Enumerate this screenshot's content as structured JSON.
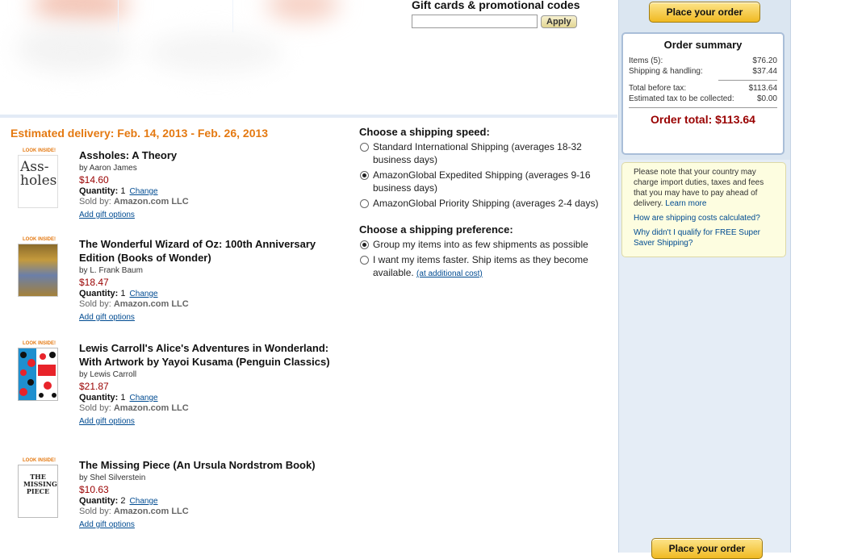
{
  "gift_cards": {
    "title": "Gift cards & promotional codes",
    "input_value": "",
    "apply_label": "Apply"
  },
  "delivery": {
    "estimate": "Estimated delivery: Feb. 14, 2013 - Feb. 26, 2013"
  },
  "items": [
    {
      "title": "Assholes: A Theory",
      "author": "by Aaron James",
      "price": "$14.60",
      "quantity_label": "Quantity:",
      "quantity": "1",
      "change_label": "Change",
      "sold_by_label": "Sold by:",
      "seller": "Amazon.com LLC",
      "gift_options_label": "Add gift options",
      "look_inside": "LOOK INSIDE!",
      "cover_text": "Ass-holes"
    },
    {
      "title": "The Wonderful Wizard of Oz: 100th Anniversary Edition (Books of Wonder)",
      "author": "by L. Frank Baum",
      "price": "$18.47",
      "quantity_label": "Quantity:",
      "quantity": "1",
      "change_label": "Change",
      "sold_by_label": "Sold by:",
      "seller": "Amazon.com LLC",
      "gift_options_label": "Add gift options",
      "look_inside": "LOOK INSIDE!",
      "cover_text": ""
    },
    {
      "title": "Lewis Carroll's Alice's Adventures in Wonderland: With Artwork by Yayoi Kusama (Penguin Classics)",
      "author": "by Lewis Carroll",
      "price": "$21.87",
      "quantity_label": "Quantity:",
      "quantity": "1",
      "change_label": "Change",
      "sold_by_label": "Sold by:",
      "seller": "Amazon.com LLC",
      "gift_options_label": "Add gift options",
      "look_inside": "LOOK INSIDE!",
      "cover_text": ""
    },
    {
      "title": "The Missing Piece (An Ursula Nordstrom Book)",
      "author": "by Shel Silverstein",
      "price": "$10.63",
      "quantity_label": "Quantity:",
      "quantity": "2",
      "change_label": "Change",
      "sold_by_label": "Sold by:",
      "seller": "Amazon.com LLC",
      "gift_options_label": "Add gift options",
      "look_inside": "LOOK INSIDE!",
      "cover_text": "THE MISSING PIECE"
    }
  ],
  "shipping_speed": {
    "title": "Choose a shipping speed:",
    "options": [
      {
        "label": "Standard International Shipping (averages 18-32 business days)",
        "selected": false
      },
      {
        "label": "AmazonGlobal Expedited Shipping (averages 9-16 business days)",
        "selected": true
      },
      {
        "label": "AmazonGlobal Priority Shipping (averages 2-4 days)",
        "selected": false
      }
    ]
  },
  "shipping_preference": {
    "title": "Choose a shipping preference:",
    "options": [
      {
        "label": "Group my items into as few shipments as possible",
        "selected": true
      },
      {
        "label": "I want my items faster. Ship items as they become available.",
        "selected": false,
        "link": "(at additional cost)"
      }
    ]
  },
  "sidebar": {
    "place_order_label": "Place your order",
    "summary": {
      "title": "Order summary",
      "items_label": "Items (5):",
      "items_value": "$76.20",
      "shipping_label": "Shipping & handling:",
      "shipping_value": "$37.44",
      "before_tax_label": "Total before tax:",
      "before_tax_value": "$113.64",
      "tax_label": "Estimated tax to be collected:",
      "tax_value": "$0.00",
      "order_total": "Order total: $113.64"
    },
    "notice": {
      "text": "Please note that your country may charge import duties, taxes and fees that you may have to pay ahead of delivery.",
      "learn_more": "Learn more",
      "link1": "How are shipping costs calculated?",
      "link2": "Why didn't I qualify for FREE Super Saver Shipping?"
    }
  },
  "colors": {
    "delivery_orange": "#e47911",
    "price_red": "#990000",
    "link_blue": "#004b91",
    "sidebar_blue": "#dbe6f1"
  }
}
